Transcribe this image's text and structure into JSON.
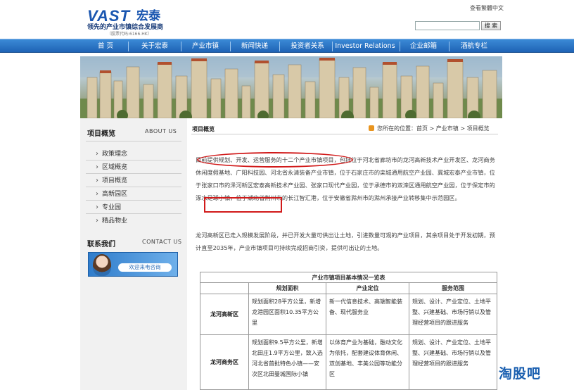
{
  "header": {
    "logo_text": "VAST",
    "logo_cn": "宏泰",
    "slogan": "领先的产业市镇综合发展商",
    "stock_code": "（股票代码:6166.HK）",
    "top_link": "查看繁體中文",
    "search_placeholder": "",
    "search_button": "搜 索"
  },
  "nav": {
    "items": [
      "首 页",
      "关于宏泰",
      "产业市镇",
      "新闻快递",
      "投资者关系",
      "Investor Relations",
      "企业邮箱",
      "酒航专栏"
    ]
  },
  "sidebar": {
    "title": "项目概览",
    "title_en": "ABOUT US",
    "items": [
      "政策理念",
      "区域概览",
      "项目概览",
      "高新园区",
      "专业园",
      "精品物业"
    ],
    "contact_title": "联系我们",
    "contact_en": "CONTACT US",
    "contact_button": "欢迎来电咨询"
  },
  "main": {
    "title": "项目概览",
    "breadcrumb_prefix": "您所在的位置：",
    "breadcrumb": [
      "首页",
      "产业市镇",
      "项目概览"
    ],
    "para1": "目前提供规划、开发、运营服务的十二个产业市镇项目，包括位于河北省廊坊市的龙河高新技术产业开发区、龙河商务休闲度假基地、广阳科技园、河北省永清装备产业市镇，位于石家庄市的栾城通用航空产业园、冀城宏泰产业市镇，位于张家口市的泽河新区宏泰高新技术产业园、张家口现代产业园，位于承德市的双滦区通用航空产业园，位于保定市的涿水足球小镇，位于湖北省荆州市的长江智汇港，位于安徽省滁州市的滁州承接产业转移集中示范园区。",
    "para2": "龙河高新区已走入规模发展阶段，并已开发大量可供出让土地，引进数量可观的产业项目，其余项目处于开发初期，预计直至2035年，产业市镇项目可持续完成招商引资，提供可出让的土地。",
    "table": {
      "caption": "产业市镇项目基本情况一览表",
      "headers": [
        "",
        "规划面积",
        "产业定位",
        "服务范围"
      ],
      "rows": [
        {
          "name": "龙河高新区",
          "area": "规划面积28平方公里，新增龙港园区面积10.35平方公里",
          "position": "新一代信息技术、高端智能装备、现代服务业",
          "service": "规划、设计、产业定位、土地平整、兴建基础、市场行销以及管理经营项目的跟进服务"
        },
        {
          "name": "龙河商务区",
          "area": "规划面积9.5平方公里，新增北田庄1.9平方公里，致入选河北省首批特色小镇——安次区北田曼城国际小镇",
          "position": "以体育产业为基础，融动文化为依托，配套建设体育休闲、双创基地、丰美公园等功能分区",
          "service": "规划、设计、产业定位、土地平整、兴建基础、市场行销以及管理经营项目的跟进服务"
        }
      ]
    }
  },
  "watermark": "淘股吧"
}
